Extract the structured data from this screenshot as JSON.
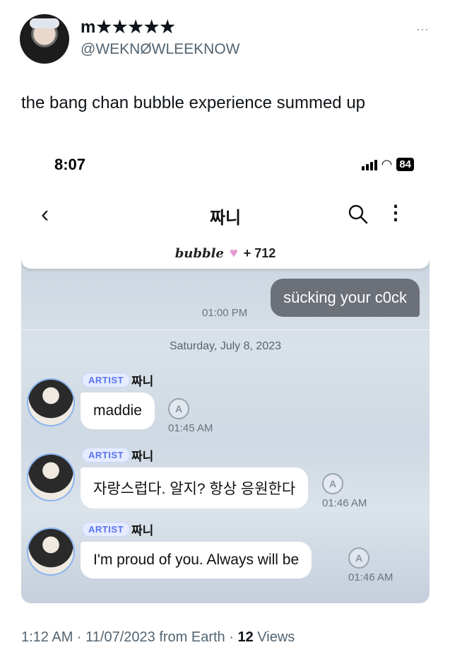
{
  "tweet": {
    "display_name": "m★★★★★",
    "handle": "@WEKNØWLEEKNOW",
    "more_icon": "⋯",
    "text": "the bang chan bubble experience summed up",
    "meta_time": "1:12 AM · 11/07/2023 from Earth · ",
    "views_count": "12",
    "views_label": " Views"
  },
  "phone": {
    "time": "8:07",
    "battery": "84",
    "chat_title": "짜니",
    "back_icon": "‹",
    "kebab_icon": "⋮",
    "bubble_logo": "bubble",
    "heart": "♥",
    "bubble_count": "+ 712",
    "sent_message": "sücking your c0ck",
    "sent_time": "01:00 PM",
    "date_divider": "Saturday, July 8, 2023",
    "messages": [
      {
        "badge": "ARTIST",
        "name": "짜니",
        "text": "maddie",
        "translate": "A",
        "time": "01:45 AM"
      },
      {
        "badge": "ARTIST",
        "name": "짜니",
        "text": "자랑스럽다. 알지? 항상 응원한다",
        "translate": "A",
        "time": "01:46 AM"
      },
      {
        "badge": "ARTIST",
        "name": "짜니",
        "text": "I'm proud of you. Always will be",
        "translate": "A",
        "time": "01:46 AM"
      }
    ]
  },
  "colors": {
    "sent_bubble": "#6c7078",
    "artist_badge": "#5b74f2",
    "heart": "#e59ad0"
  },
  "icons": [
    "more-icon",
    "back-icon",
    "search-icon",
    "kebab-icon",
    "heart-icon",
    "signal-icon",
    "wifi-icon",
    "battery-icon",
    "translate-icon"
  ]
}
